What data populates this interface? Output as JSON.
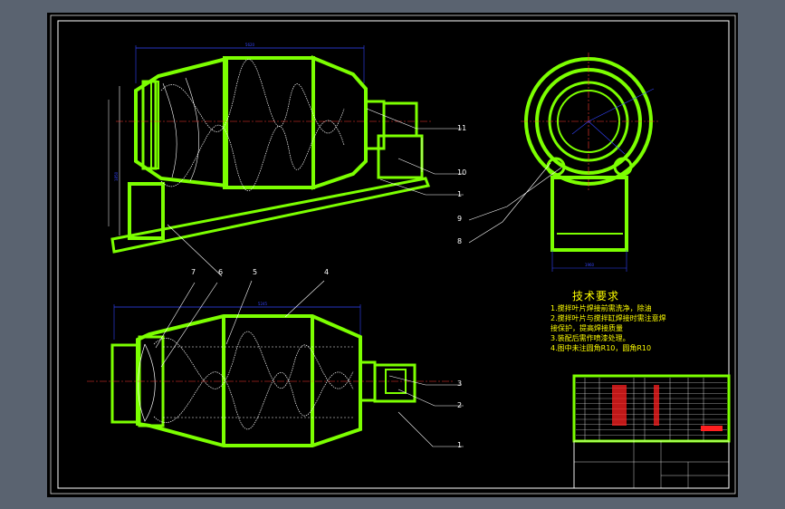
{
  "drawing": {
    "colors": {
      "background_outer": "#5a6370",
      "sheet": "#000000",
      "frame": "#ffffff",
      "part_outline": "#7cff00",
      "helix_blades": "#ffffff",
      "center_lines": "#ff3b30",
      "dimensions": "#3344ff",
      "notes_text": "#ffff00",
      "title_block_text": "#ff2020"
    },
    "views": [
      "side-view",
      "top-view",
      "end-view"
    ],
    "dimensions": {
      "side_overall": "5620",
      "top_overall": "5245",
      "side_height": "1850",
      "end_base_width": "1960"
    }
  },
  "part_numbers": {
    "side_view": [
      "11",
      "10",
      "1",
      "9",
      "8"
    ],
    "top_view_upper": [
      "7",
      "6",
      "5",
      "4"
    ],
    "top_view_right": [
      "3",
      "2",
      "1"
    ]
  },
  "tech_requirements": {
    "title": "技术要求",
    "items": [
      "1.搅拌叶片焊接前需洗净，除油",
      "2.搅拌叶片与搅拌缸焊接时需注意焊",
      "接保护，提高焊接质量",
      "3.装配后需作喷漆处理。",
      "4.图中未注圆角R10，圆角R10"
    ]
  },
  "title_block": {
    "rows": 12
  }
}
